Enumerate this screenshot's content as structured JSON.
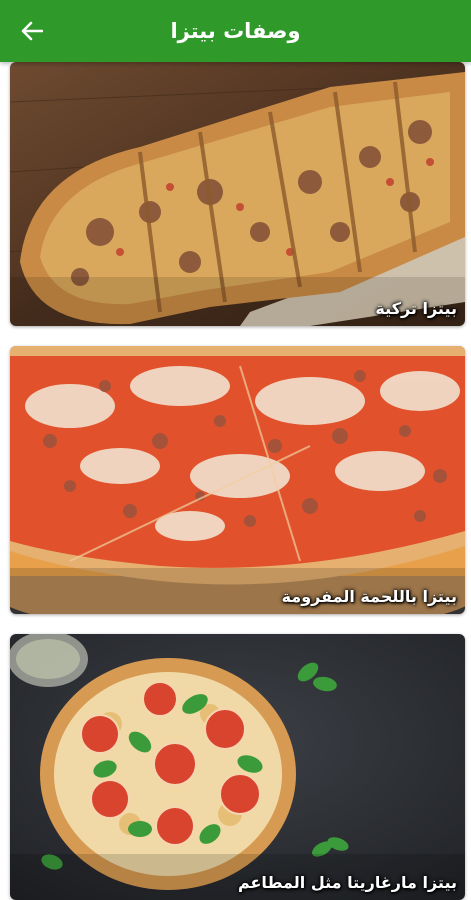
{
  "app": {
    "title": "وصفات بيتزا",
    "back_icon": "arrow-back-icon",
    "accent_color": "#2f9a2a"
  },
  "recipes": [
    {
      "title": "بيتزا تركية"
    },
    {
      "title": "بيتزا باللحمة المفرومة"
    },
    {
      "title": "بيتزا مارغاريتا مثل المطاعم"
    }
  ]
}
